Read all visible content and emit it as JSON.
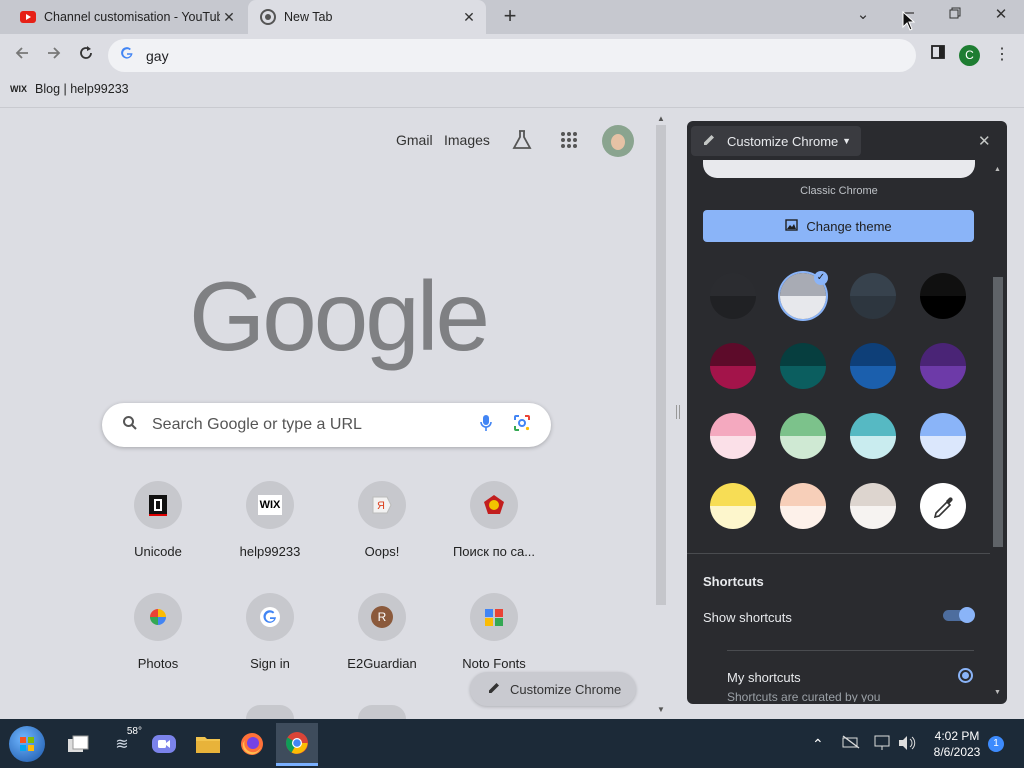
{
  "tabs": [
    {
      "title": "Channel customisation - YouTube"
    },
    {
      "title": "New Tab"
    }
  ],
  "omnibox": {
    "text": "gay"
  },
  "bookmarks": [
    {
      "icon_text": "WIX",
      "label": "Blog | help99233"
    }
  ],
  "page": {
    "gmail": "Gmail",
    "images": "Images",
    "logo": "Google",
    "search_placeholder": "Search Google or type a URL",
    "shortcuts": [
      {
        "label": "Unicode"
      },
      {
        "label": "help99233",
        "icon_text": "WIX"
      },
      {
        "label": "Oops!"
      },
      {
        "label": "Поиск по са..."
      },
      {
        "label": "Photos"
      },
      {
        "label": "Sign in"
      },
      {
        "label": "E2Guardian",
        "icon_text": "R"
      },
      {
        "label": "Noto Fonts"
      }
    ],
    "customize_button": "Customize Chrome"
  },
  "panel": {
    "title": "Customize Chrome",
    "classic_label": "Classic Chrome",
    "change_theme": "Change theme",
    "themes": [
      {
        "top": "#2b2c30",
        "bottom": "#202124"
      },
      {
        "top": "#a8abb4",
        "bottom": "#e7e8ec",
        "selected": true
      },
      {
        "top": "#37424d",
        "bottom": "#2d363f"
      },
      {
        "top": "#101010",
        "bottom": "#000000"
      },
      {
        "top": "#5d0b2a",
        "bottom": "#a3144a"
      },
      {
        "top": "#063e3f",
        "bottom": "#0b5e5f"
      },
      {
        "top": "#0e3f78",
        "bottom": "#1b5fad"
      },
      {
        "top": "#4a2476",
        "bottom": "#6d3aa8"
      },
      {
        "top": "#f4a9bf",
        "bottom": "#fbe0e8"
      },
      {
        "top": "#7cc28b",
        "bottom": "#cfe9d3"
      },
      {
        "top": "#56b9c3",
        "bottom": "#c9ecef"
      },
      {
        "top": "#8ab4f8",
        "bottom": "#dbe7fc"
      },
      {
        "top": "#f7dd55",
        "bottom": "#fdf6cc"
      },
      {
        "top": "#f7cfb9",
        "bottom": "#fdf1ea"
      },
      {
        "top": "#ddd5cf",
        "bottom": "#f6f3f1"
      },
      {
        "custom": true
      }
    ],
    "shortcuts_heading": "Shortcuts",
    "show_shortcuts": "Show shortcuts",
    "show_shortcuts_on": true,
    "my_shortcuts": "My shortcuts",
    "my_shortcuts_desc": "Shortcuts are curated by you"
  },
  "taskbar": {
    "weather": "58°",
    "time": "4:02 PM",
    "date": "8/6/2023",
    "notifications": "1"
  }
}
